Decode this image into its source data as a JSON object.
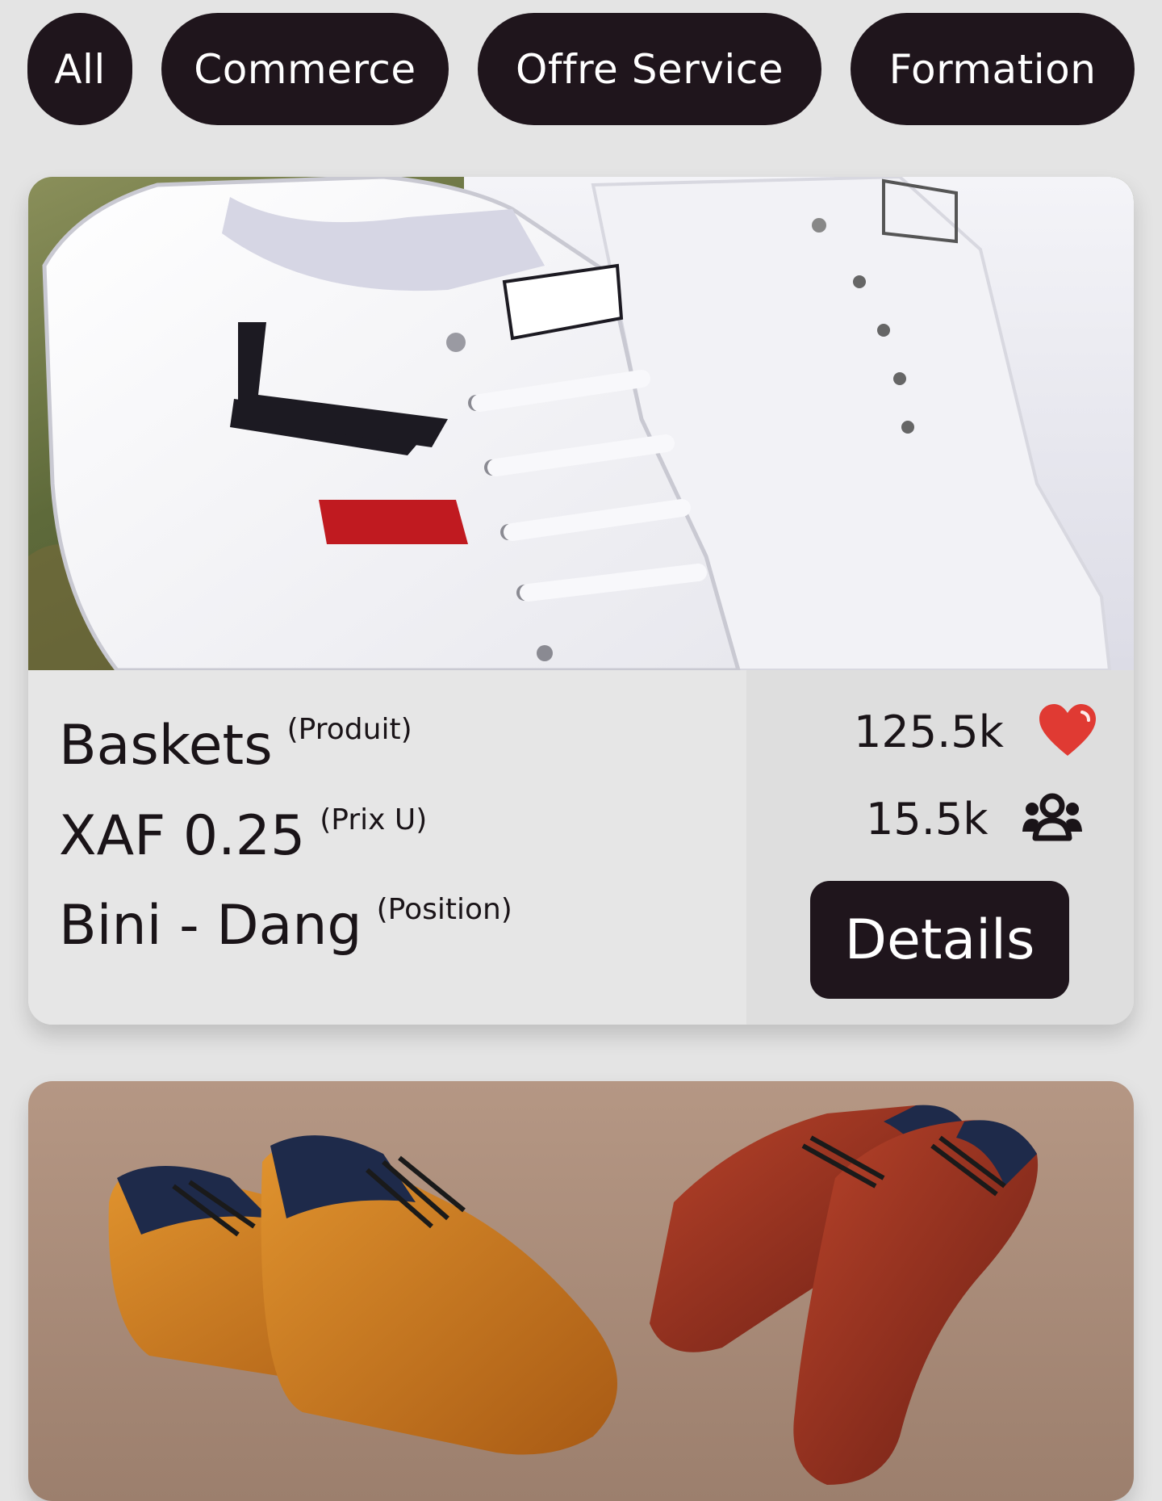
{
  "filters": {
    "all": "All",
    "commerce": "Commerce",
    "offre_service": "Offre Service",
    "formation": "Formation"
  },
  "cards": [
    {
      "name": "Baskets",
      "name_tag": "(Produit)",
      "price": "XAF 0.25",
      "price_tag": "(Prix U)",
      "position": "Bini - Dang",
      "position_tag": "(Position)",
      "likes": "125.5k",
      "followers": "15.5k",
      "details_label": "Details",
      "image": "white-sneakers-photo"
    },
    {
      "image": "brogue-shoes-photo"
    }
  ],
  "icons": {
    "likes": "heart-icon",
    "followers": "users-icon"
  },
  "colors": {
    "background": "#e4e4e4",
    "chip": "#1f151c",
    "heart": "#e03a33"
  }
}
